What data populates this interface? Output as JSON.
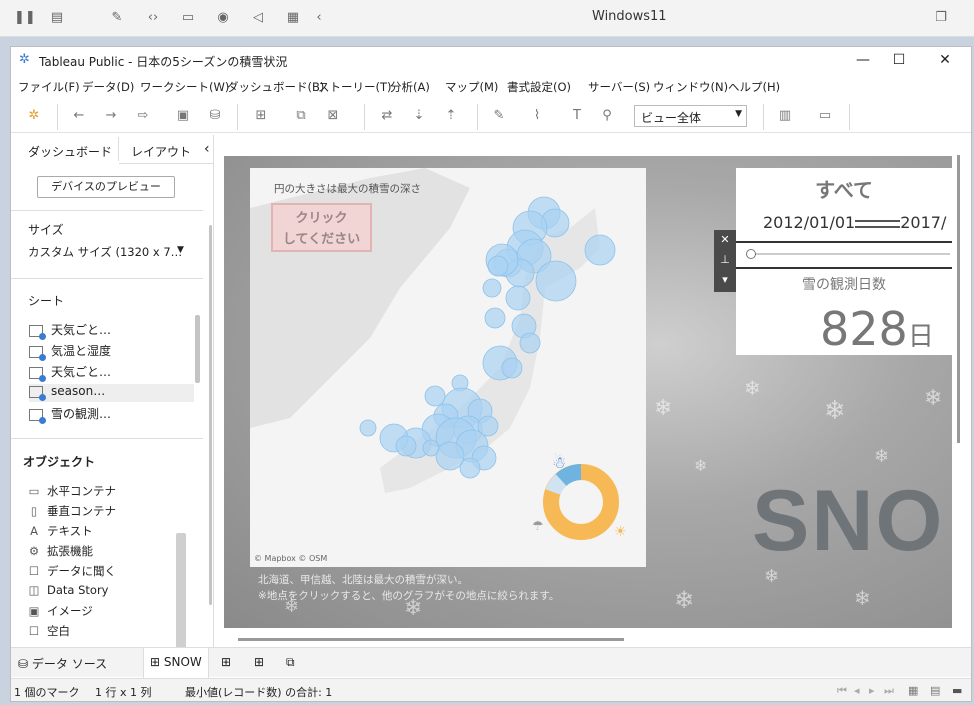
{
  "vm": {
    "title": "Windows11"
  },
  "window": {
    "title": "Tableau Public - 日本の5シーズンの積雪状況"
  },
  "menu": [
    "ファイル(F)",
    "データ(D)",
    "ワークシート(W)",
    "ダッシュボード(B)",
    "ストーリー(T)",
    "分析(A)",
    "マップ(M)",
    "書式設定(O)",
    "サーバー(S)",
    "ウィンドウ(N)",
    "ヘルプ(H)"
  ],
  "toolbar": {
    "view_select": "ビュー全体"
  },
  "left_panel": {
    "tabs": [
      "ダッシュボード",
      "レイアウト"
    ],
    "device_preview_button": "デバイスのプレビュー",
    "size_heading": "サイズ",
    "size_value": "カスタム サイズ (1320 x 7…",
    "sheets_heading": "シート",
    "sheets": [
      "天気ごと…",
      "気温と湿度",
      "天気ごと…",
      "season…",
      "雪の観測…"
    ],
    "objects_heading": "オブジェクト",
    "objects": [
      {
        "icon": "horizontal-container-icon",
        "label": "水平コンテナ"
      },
      {
        "icon": "vertical-container-icon",
        "label": "垂直コンテナ"
      },
      {
        "icon": "text-icon",
        "label": "テキスト"
      },
      {
        "icon": "extension-icon",
        "label": "拡張機能"
      },
      {
        "icon": "ask-data-icon",
        "label": "データに聞く"
      },
      {
        "icon": "data-story-icon",
        "label": "Data Story"
      },
      {
        "icon": "image-icon",
        "label": "イメージ"
      },
      {
        "icon": "blank-icon",
        "label": "空白"
      }
    ]
  },
  "dashboard": {
    "map_note": "円の大きさは最大の積雪の深さ",
    "click_box": [
      "クリック",
      "してください"
    ],
    "map_credit": "© Mapbox © OSM",
    "caption_lines": [
      "北海道、甲信越、北陸は最大の積雪が深い。",
      "※地点をクリックすると、他のグラフがその地点に絞られます。"
    ],
    "filter_all": "すべて",
    "date_start": "2012/01/01",
    "date_end": "2017/",
    "count_label": "雪の観測日数",
    "count_value": "828",
    "count_unit": "日",
    "big_text": "SNO"
  },
  "bottom_tabs": [
    "データ ソース",
    "SNOW"
  ],
  "status": {
    "marks": "1 個のマーク",
    "rows_cols": "1 行 x 1 列",
    "min_sum": "最小値(レコード数) の合計: 1"
  },
  "colors": {
    "bubble": "#a9d2f2",
    "donut_main": "#f7b955",
    "donut_secondary": "#6fb4e0"
  }
}
